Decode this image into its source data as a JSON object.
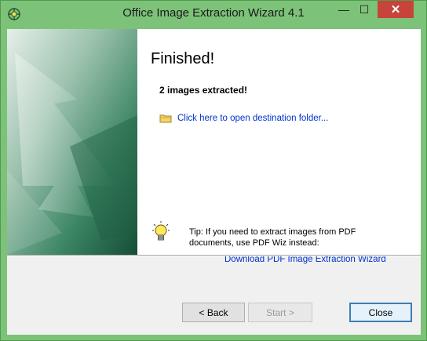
{
  "window": {
    "title": "Office Image Extraction Wizard 4.1",
    "controls": {
      "minimize": "—",
      "maximize": "☐",
      "close": "✕"
    },
    "accent_color": "#7dc279",
    "close_color": "#c7443a"
  },
  "content": {
    "heading": "Finished!",
    "count_text": "2 images extracted!",
    "folder_link": "Click here to open destination folder...",
    "tip_text": "Tip: If you need to extract images from PDF documents, use PDF Wiz instead:",
    "download_link": "Download PDF Image Extraction Wizard",
    "link_color": "#0033cc"
  },
  "icons": [
    "app-icon",
    "folder-icon",
    "lightbulb-icon"
  ],
  "buttons": {
    "back": "< Back",
    "start": "Start >",
    "close": "Close"
  }
}
